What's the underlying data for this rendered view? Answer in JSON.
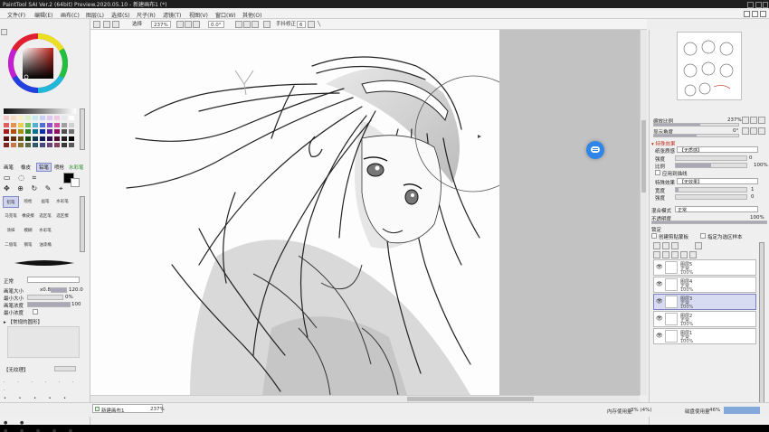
{
  "app": {
    "title": "PaintTool SAI Ver.2 (64bit) Preview.2020.05.10 - 新建画布1 (*)"
  },
  "menu": {
    "items": [
      "文件(F)",
      "编辑(E)",
      "画布(C)",
      "图层(L)",
      "选择(S)",
      "尺子(R)",
      "滤镜(T)",
      "视图(V)",
      "窗口(W)",
      "其他(O)"
    ]
  },
  "toolbar": {
    "mode_label": "选择",
    "zoom": "237%",
    "rotation": "0.0°",
    "stabilizer_label": "手抖修正",
    "stabilizer_value": "6"
  },
  "tool_tabs": [
    "画笔",
    "橡皮",
    "铅笔",
    "喷枪",
    "水彩笔"
  ],
  "tools": {
    "row1": [
      "铅笔",
      "喷枪",
      "画笔",
      "水彩笔"
    ],
    "row2": [
      "马克笔",
      "橡皮擦",
      "选区笔",
      "选区擦"
    ],
    "row3": [
      "涂抹",
      "模糊",
      "水彩笔"
    ],
    "row4": [
      "二值笔",
      "钢笔",
      "油漆桶"
    ]
  },
  "brush": {
    "blend_mode": "正常",
    "size_label": "画笔大小",
    "size_mult": "x0.8",
    "size_value": "120.0",
    "min_size_label": "最小大小",
    "min_size_value": "0%",
    "density_label": "画笔浓度",
    "density_value": "100",
    "min_density_label": "最小浓度",
    "shape_label": "【常规的圆形】",
    "texture_label": "【无纹理】"
  },
  "navigator": {
    "zoom_label": "缩放比例",
    "zoom_value": "237%",
    "angle_label": "显示角度",
    "angle_value": "0°"
  },
  "effects": {
    "section_label": "特殊效果",
    "paper_label": "纸张质感",
    "paper_value": "【无质感】",
    "strength_label": "强度",
    "strength_value": "0",
    "scale_label": "比例",
    "scale_value": "100%",
    "apply_label": "应用到描线",
    "effect_label": "特殊效果",
    "effect_value": "【无效果】",
    "width_label": "宽度",
    "width_value": "1",
    "intensity_label": "强度",
    "intensity_value": "0"
  },
  "layer_props": {
    "blend_label": "混合模式",
    "blend_value": "正常",
    "opacity_label": "不透明度",
    "opacity_value": "100%",
    "protect_label": "锁定",
    "clip_label": "创建剪贴蒙板",
    "ref_label": "指定为选区样本"
  },
  "layers": [
    {
      "name": "图层5",
      "mode": "正常",
      "opacity": "100%",
      "selected": false
    },
    {
      "name": "图层4",
      "mode": "正常",
      "opacity": "100%",
      "selected": false
    },
    {
      "name": "图层3",
      "mode": "正常",
      "opacity": "100%",
      "selected": true
    },
    {
      "name": "图层2",
      "mode": "正常",
      "opacity": "100%",
      "selected": false
    },
    {
      "name": "图层1",
      "mode": "正常",
      "opacity": "100%",
      "selected": false
    }
  ],
  "status": {
    "doc_name": "新建画布1",
    "doc_zoom": "237%",
    "memory_label": "内存使用量",
    "memory_value": "3% (4%)",
    "disk_label": "磁盘使用量",
    "disk_value": "46%"
  },
  "colors": {
    "accent": "#7a80c0",
    "bubble": "#2f86e8"
  },
  "icons": [
    "close-icon",
    "minimize-icon",
    "maximize-icon",
    "eye-icon",
    "chat-bubble-icon",
    "brush-cursor-icon"
  ]
}
